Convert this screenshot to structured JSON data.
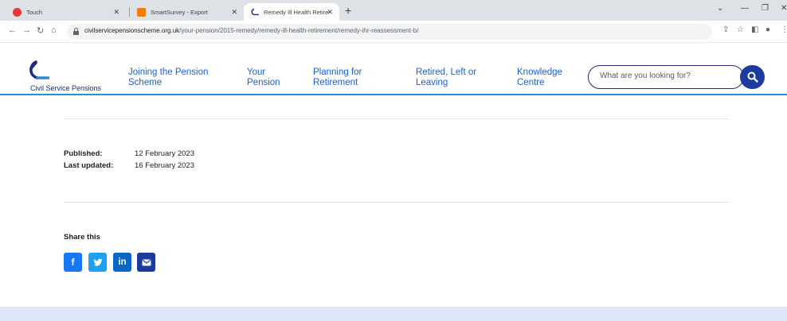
{
  "browser": {
    "tabs": [
      {
        "title": "Touch",
        "favicon_color": "#e53935"
      },
      {
        "title": "SmartSurvey - Export",
        "favicon_color": "#f57c00"
      },
      {
        "title": "Remedy Ill Health Retirement Re",
        "favicon_color": "#1c2b82",
        "active": true
      }
    ],
    "new_tab_icon": "+",
    "url_host": "civilservicepensionscheme.org.uk",
    "url_path": "/your-pension/2015-remedy/remedy-ill-health-retirement/remedy-ihr-reassessment-b/"
  },
  "site": {
    "logo_text": "Civil Service Pensions",
    "nav": [
      {
        "line1": "Joining the Pension",
        "line2": "Scheme"
      },
      {
        "line1": "Your",
        "line2": "Pension"
      },
      {
        "line1": "Planning for",
        "line2": "Retirement"
      },
      {
        "line1": "Retired, Left or",
        "line2": "Leaving"
      },
      {
        "line1": "Knowledge",
        "line2": "Centre"
      }
    ],
    "search": {
      "placeholder": "What are you looking for?"
    },
    "colors": {
      "brand_navy": "#1d3a9e",
      "link_blue": "#1c5fd1",
      "rule_blue": "#2d8bd5"
    }
  },
  "content": {
    "published_label": "Published:",
    "published_value": "12 February 2023",
    "updated_label": "Last updated:",
    "updated_value": "16 February 2023",
    "share_title": "Share this",
    "share_buttons": [
      {
        "network": "facebook",
        "glyph": "f",
        "color": "#1877f2"
      },
      {
        "network": "twitter",
        "glyph": "twitter-bird-icon",
        "color": "#1da1f2"
      },
      {
        "network": "linkedin",
        "glyph": "in",
        "color": "#0a66c2"
      },
      {
        "network": "email",
        "glyph": "envelope-icon",
        "color": "#1d3a9e"
      }
    ]
  }
}
